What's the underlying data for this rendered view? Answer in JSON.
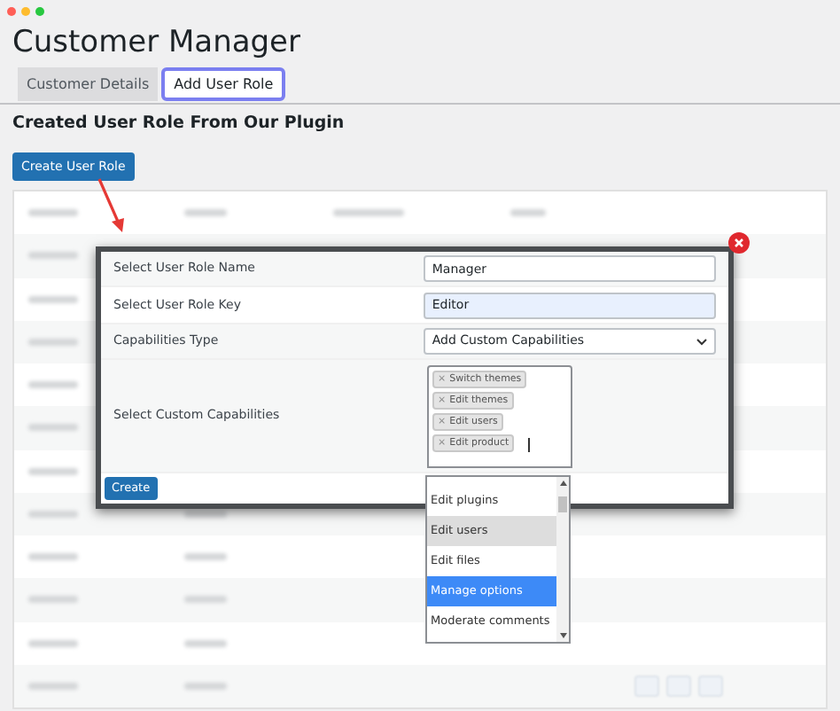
{
  "window": {
    "title": "Customer Manager"
  },
  "tabs": [
    {
      "label": "Customer Details",
      "selected": false
    },
    {
      "label": "Add User Role",
      "selected": true
    }
  ],
  "heading": "Created User Role From Our Plugin",
  "create_role_button": "Create User Role",
  "dialog": {
    "fields": [
      {
        "kind": "text",
        "label": "Select User Role Name",
        "value": "Manager",
        "highlighted": false
      },
      {
        "kind": "text",
        "label": "Select User Role Key",
        "value": "Editor",
        "highlighted": true
      },
      {
        "kind": "select",
        "label": "Capabilities Type",
        "value": "Add Custom Capabilities"
      },
      {
        "kind": "multiselect",
        "label": "Select Custom Capabilities",
        "tags": [
          {
            "remove": "×",
            "label": "Switch themes"
          },
          {
            "remove": "×",
            "label": "Edit themes"
          },
          {
            "remove": "×",
            "label": "Edit users"
          },
          {
            "remove": "×",
            "label": "Edit product"
          }
        ],
        "options": [
          {
            "label": "Edit plugins",
            "highlighted": false,
            "selected": false
          },
          {
            "label": "Edit users",
            "highlighted": true,
            "selected": false
          },
          {
            "label": "Edit files",
            "highlighted": false,
            "selected": false
          },
          {
            "label": "Manage options",
            "highlighted": false,
            "selected": true
          },
          {
            "label": "Moderate comments",
            "highlighted": false,
            "selected": false
          }
        ]
      }
    ],
    "submit": "Create"
  }
}
